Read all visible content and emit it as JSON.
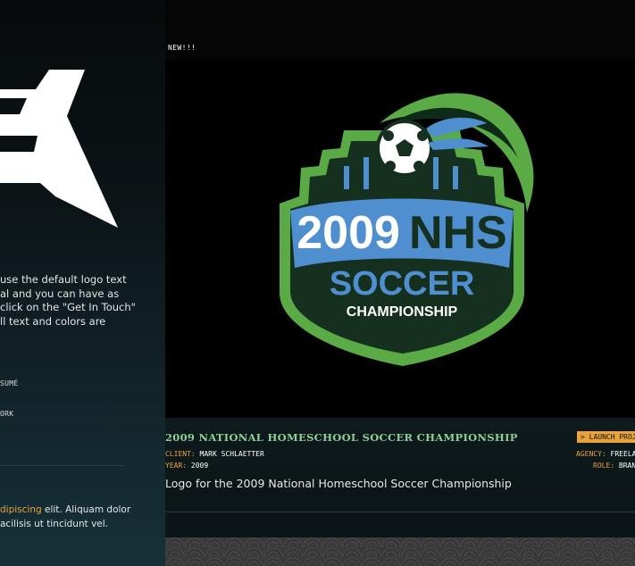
{
  "sidebar": {
    "intro_lines": [
      "use the default logo text",
      "al and you can have as",
      "click on the \"Get In Touch\"",
      "ll text and colors are"
    ],
    "links": [
      "SUMÉ",
      "ORK"
    ],
    "bottom": {
      "highlight": "dipiscing",
      "line1_rest": " elit. Aliquam dolor",
      "line2": "acilisis ut tincidunt vel."
    }
  },
  "main": {
    "new_tag": "NEW!!!",
    "badge": {
      "year": "2009",
      "org": "NHS",
      "sport": "SOCCER",
      "event": "CHAMPIONSHIP"
    },
    "project": {
      "title": "2009 NATIONAL HOMESCHOOL SOCCER CHAMPIONSHIP",
      "client_label": "CLIENT:",
      "client": "MARK SCHLAETTER",
      "year_label": "YEAR:",
      "year": "2009",
      "agency_label": "AGENCY:",
      "agency": "FREELA",
      "role_label": "ROLE:",
      "role": "BRAND",
      "launch": "> LAUNCH PROJE",
      "description": "Logo for the 2009 National Homeschool Soccer Championship"
    }
  },
  "colors": {
    "accent_orange": "#e8a33a",
    "title_green": "#8fcf9a",
    "badge_green": "#5aab45",
    "badge_blue": "#4f8fcf",
    "badge_dark": "#15301f"
  }
}
